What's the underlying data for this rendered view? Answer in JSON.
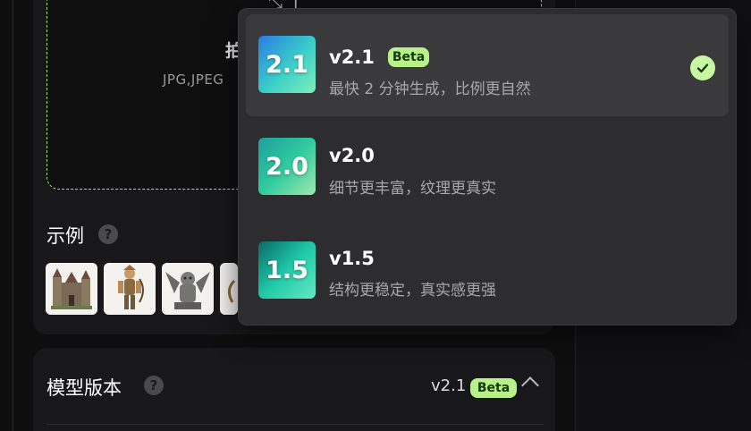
{
  "upload": {
    "title_partial": "拍",
    "formats_partial": "JPG,JPEG"
  },
  "examples": {
    "label": "示例",
    "help": "?"
  },
  "model": {
    "label": "模型版本",
    "help": "?",
    "value": "v2.1",
    "badge": "Beta"
  },
  "dropdown": {
    "options": [
      {
        "icon_text": "2.1",
        "title": "v2.1",
        "badge": "Beta",
        "desc": "最快 2 分钟生成，比例更自然",
        "selected": true
      },
      {
        "icon_text": "2.0",
        "title": "v2.0",
        "desc": "细节更丰富，纹理更真实"
      },
      {
        "icon_text": "1.5",
        "title": "v1.5",
        "desc": "结构更稳定，真实感更强"
      }
    ]
  },
  "colors": {
    "accent": "#b8f08a",
    "dashed_border": "#9ee26b"
  }
}
